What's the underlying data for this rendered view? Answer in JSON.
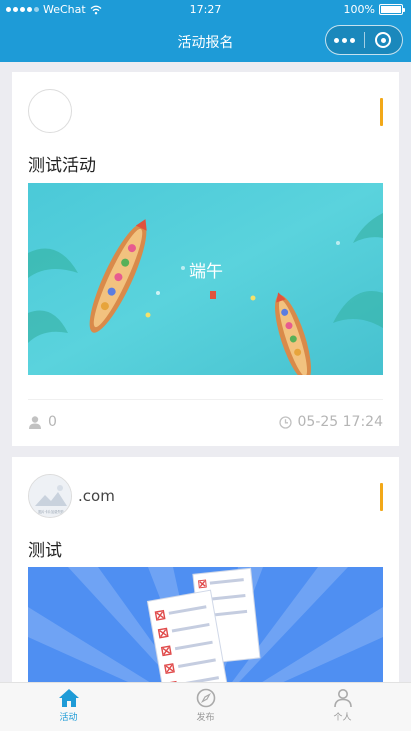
{
  "status_bar": {
    "carrier": "WeChat",
    "time": "17:27",
    "battery": "100%",
    "battery_level": 1.0
  },
  "nav": {
    "title": "活动报名"
  },
  "cards": [
    {
      "username": "",
      "title": "测试活动",
      "banner_text": "端午",
      "participants": "0",
      "date": "05-25 17:24"
    },
    {
      "username": ".com",
      "title": "测试",
      "avatar_caption": "图片卡片加载失败"
    }
  ],
  "tabbar": {
    "items": [
      {
        "label": "活动",
        "icon": "house-icon",
        "active": true
      },
      {
        "label": "发布",
        "icon": "compass-icon",
        "active": false
      },
      {
        "label": "个人",
        "icon": "person-icon",
        "active": false
      }
    ]
  },
  "colors": {
    "brand": "#1e9bd7",
    "accent": "#f2a818",
    "muted": "#b5b5b5"
  }
}
